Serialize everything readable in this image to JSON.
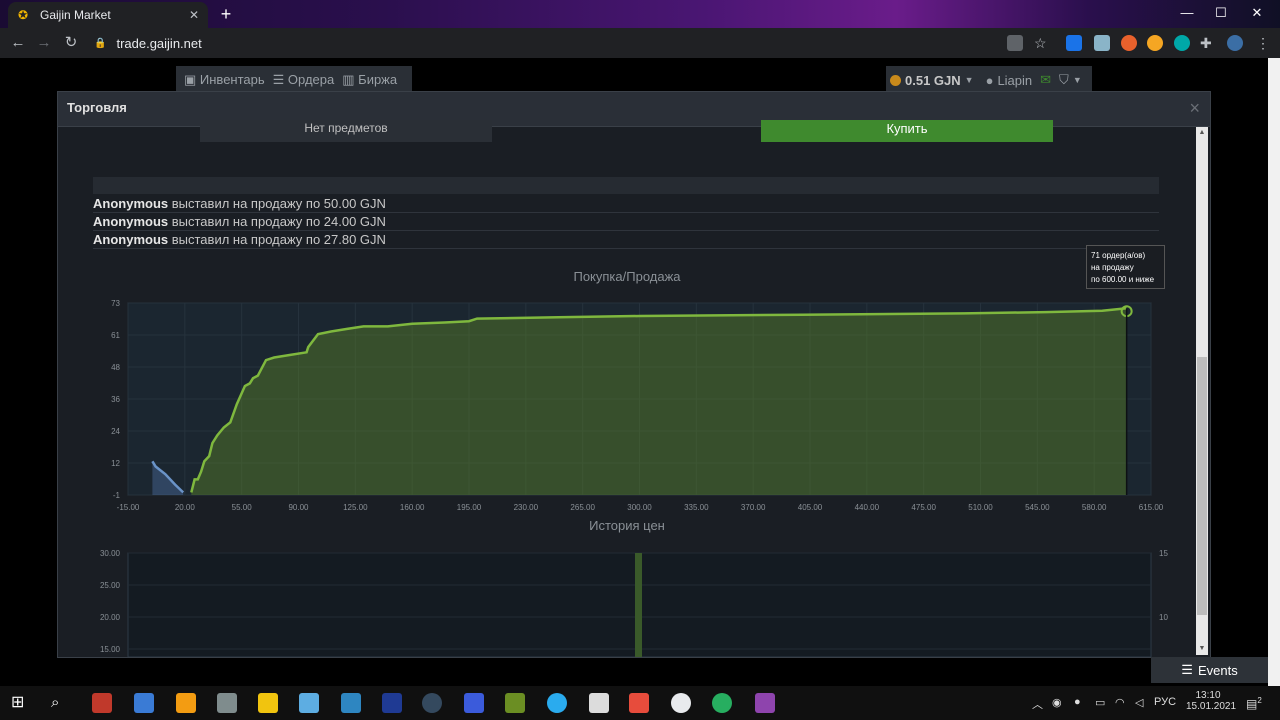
{
  "browser": {
    "tab_title": "Gaijin Market",
    "url": "trade.gaijin.net"
  },
  "site": {
    "nav": [
      "Инвентарь",
      "Ордера",
      "Биржа"
    ],
    "balance": "0.51 GJN",
    "username": "Liapin"
  },
  "modal": {
    "title": "Торговля",
    "close": "×",
    "no_items_label": "Нет предметов",
    "buy_label": "Купить"
  },
  "feed": [
    {
      "user": "Anonymous",
      "text": "выставил на продажу по 50.00 GJN"
    },
    {
      "user": "Anonymous",
      "text": "выставил на продажу по 24.00 GJN"
    },
    {
      "user": "Anonymous",
      "text": "выставил на продажу по 27.80 GJN"
    }
  ],
  "tooltip": [
    "71 ордер(а/ов)",
    "на продажу",
    "по 600.00 и ниже"
  ],
  "events_label": "Events",
  "taskbar": {
    "lang": "РУС",
    "time": "13:10",
    "date": "15.01.2021",
    "notif_count": "2"
  },
  "colors": {
    "buy_green": "#3f8a2e",
    "depth_sell_line": "#7fb83e",
    "depth_buy_line": "#6a93c8"
  },
  "chart_data": [
    {
      "type": "area",
      "title": "Покупка/Продажа",
      "x_ticks": [
        "-15.00",
        "20.00",
        "55.00",
        "90.00",
        "125.00",
        "160.00",
        "195.00",
        "230.00",
        "265.00",
        "300.00",
        "335.00",
        "370.00",
        "405.00",
        "440.00",
        "475.00",
        "510.00",
        "545.00",
        "580.00",
        "615.00"
      ],
      "y_ticks": [
        "73",
        "61",
        "48",
        "36",
        "24",
        "12",
        "-1"
      ],
      "xlim": [
        -15,
        615
      ],
      "ylim": [
        -1,
        73
      ],
      "grid": true,
      "series": [
        {
          "x": [
            0,
            2,
            8,
            14,
            19
          ],
          "y": [
            12,
            10,
            7,
            3,
            0
          ]
        },
        {
          "x": [
            24,
            26,
            28,
            30,
            32,
            35,
            37,
            40,
            44,
            48,
            52,
            57,
            60,
            62,
            65,
            70,
            75,
            85,
            95,
            96,
            102,
            110,
            120,
            130,
            145,
            160,
            180,
            195,
            200,
            250,
            300,
            400,
            500,
            550,
            585,
            600
          ],
          "y": [
            0,
            5,
            5,
            8,
            12,
            14,
            19,
            22,
            25,
            27,
            34,
            41,
            42,
            44,
            45,
            51,
            52,
            53,
            54,
            56,
            61,
            62,
            63,
            64,
            64,
            65,
            65.5,
            66,
            67,
            67.5,
            68,
            68.5,
            69,
            69.5,
            70,
            71
          ]
        }
      ]
    },
    {
      "type": "line",
      "title": "История цен",
      "y_ticks_left": [
        "30.00",
        "25.00",
        "20.00",
        "15.00"
      ],
      "y_ticks_right": [
        "15",
        "10"
      ],
      "grid": true
    }
  ]
}
